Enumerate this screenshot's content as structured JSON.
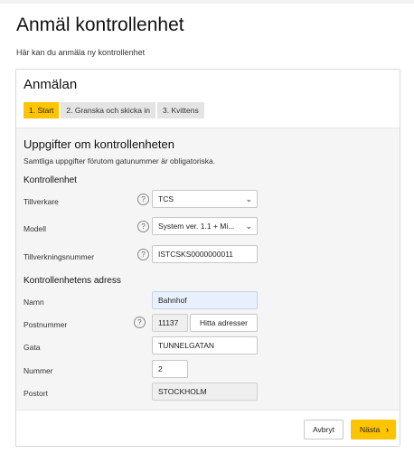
{
  "page": {
    "title": "Anmäl kontrollenhet",
    "subtitle": "Här kan du anmäla ny kontrollenhet"
  },
  "card": {
    "title": "Anmälan",
    "steps": [
      {
        "label": "1. Start",
        "active": true
      },
      {
        "label": "2. Granska och skicka in",
        "active": false
      },
      {
        "label": "3. Kvittens",
        "active": false
      }
    ]
  },
  "section": {
    "title": "Uppgifter om kontrollenheten",
    "description": "Samtliga uppgifter förutom gatunummer är obligatoriska."
  },
  "unit": {
    "heading": "Kontrollenhet",
    "manufacturer": {
      "label": "Tillverkare",
      "value": "TCS"
    },
    "model": {
      "label": "Modell",
      "value": "System ver. 1.1 + Mi..."
    },
    "serial": {
      "label": "Tillverkningsnummer",
      "value": "ISTCSKS0000000011"
    }
  },
  "address": {
    "heading": "Kontrollenhetens adress",
    "name": {
      "label": "Namn",
      "value": "Bahnhof"
    },
    "postal_code": {
      "label": "Postnummer",
      "value": "11137",
      "find_button": "Hitta adresser"
    },
    "street": {
      "label": "Gata",
      "value": "TUNNELGATAN"
    },
    "number": {
      "label": "Nummer",
      "value": "2"
    },
    "city": {
      "label": "Postort",
      "value": "STOCKHOLM"
    }
  },
  "footer": {
    "cancel_label": "Avbryt",
    "next_label": "Nästa"
  },
  "icons": {
    "help": "question-mark-icon",
    "select": "chevron-down-icon",
    "next": "chevron-right-icon"
  },
  "colors": {
    "accent": "#ffc400",
    "focus_field": "#e8f0fe"
  }
}
